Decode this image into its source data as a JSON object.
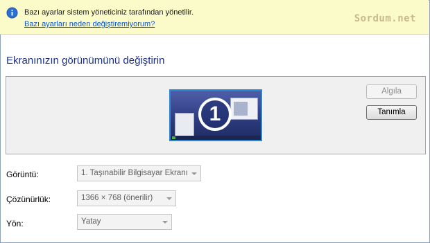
{
  "infobar": {
    "message": "Bazı ayarlar sistem yöneticiniz tarafından yönetilir.",
    "link": "Bazı ayarları neden değiştiremiyorum?",
    "watermark": "Sordum.net",
    "background": "#fbfbc9"
  },
  "heading": "Ekranınızın görünümünü değiştirin",
  "preview": {
    "monitor_number": "1",
    "detect_button": "Algıla",
    "identify_button": "Tanımla"
  },
  "settings": {
    "display_label": "Görüntü:",
    "display_value": "1. Taşınabilir Bilgisayar Ekranı",
    "resolution_label": "Çözünürlük:",
    "resolution_value": "1366 × 768 (önerilir)",
    "orientation_label": "Yön:",
    "orientation_value": "Yatay"
  },
  "colors": {
    "heading": "#1e3287",
    "link": "#0b57d0",
    "monitor_border": "#2b86d6"
  },
  "icons": {
    "info": "info-icon",
    "dropdown": "chevron-down-icon"
  }
}
